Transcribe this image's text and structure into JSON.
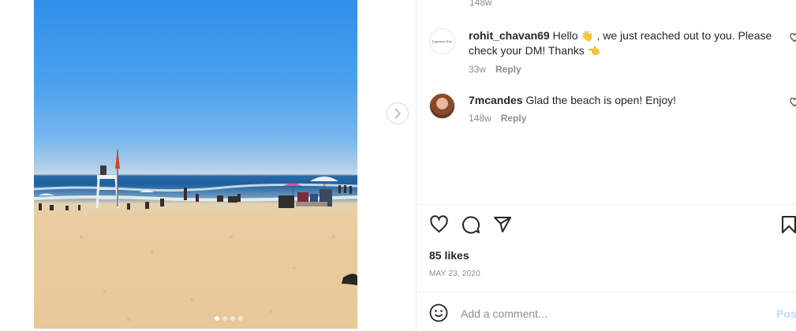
{
  "photo": {
    "carousel": {
      "dot_count": 4,
      "active_index": 0
    }
  },
  "comments": {
    "previous_time": "148w",
    "items": [
      {
        "username": "rohit_chavan69",
        "text_before": "Hello",
        "emoji1": "👋",
        "text_middle": ", we just reached out to you. Please check your DM! Thanks",
        "emoji2": "👈",
        "time": "33w",
        "reply_label": "Reply",
        "avatar_text": "Jugaado Kits"
      },
      {
        "username": "7mcandes",
        "text": "Glad the beach is open! Enjoy!",
        "time": "148w",
        "reply_label": "Reply"
      }
    ]
  },
  "post": {
    "likes": "85 likes",
    "date": "MAY 23, 2020"
  },
  "add_comment": {
    "placeholder": "Add a comment...",
    "post_label": "Post"
  },
  "icons": {
    "next": "chevron-right-icon",
    "like": "heart-icon",
    "comment": "comment-bubble-icon",
    "share": "paper-plane-icon",
    "save": "bookmark-icon",
    "emoji": "smile-icon"
  }
}
